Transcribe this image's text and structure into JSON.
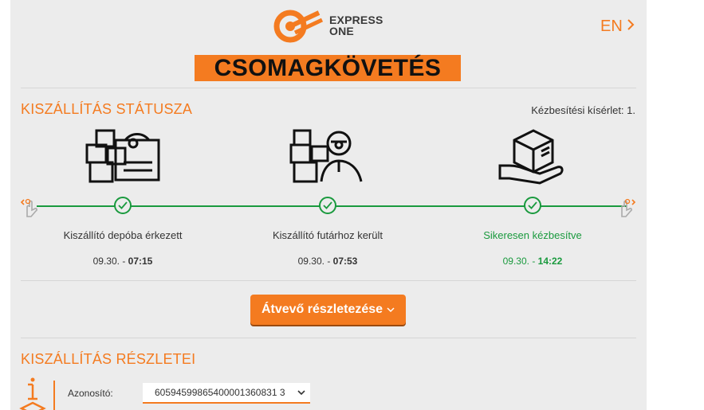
{
  "brand": {
    "name_line1": "EXPRESS",
    "name_line2": "ONE",
    "accent": "#f47b20",
    "success": "#1a9a3e"
  },
  "header": {
    "lang_label": "EN",
    "lang_icon": "chevron-right-icon",
    "banner_title": "CSOMAGKÖVETÉS"
  },
  "status": {
    "title": "KISZÁLLÍTÁS STÁTUSZA",
    "attempt_text": "Kézbesítési kísérlet: 1.",
    "steps": [
      {
        "label": "Kiszállító depóba érkezett",
        "date": "09.30. - ",
        "time": "07:15",
        "icon": "depot-building-icon"
      },
      {
        "label": "Kiszállító futárhoz került",
        "date": "09.30. - ",
        "time": "07:53",
        "icon": "courier-icon"
      },
      {
        "label": "Sikeresen kézbesítve",
        "date": "09.30. - ",
        "time": "14:22",
        "icon": "delivered-package-hand-icon"
      }
    ]
  },
  "recipient_button": {
    "label": "Átvevő részletezése",
    "icon": "chevron-down-icon"
  },
  "details": {
    "title": "KISZÁLLÍTÁS RÉSZLETEI",
    "id_label": "Azonosító:",
    "id_value": "60594599865400001360831 3"
  }
}
